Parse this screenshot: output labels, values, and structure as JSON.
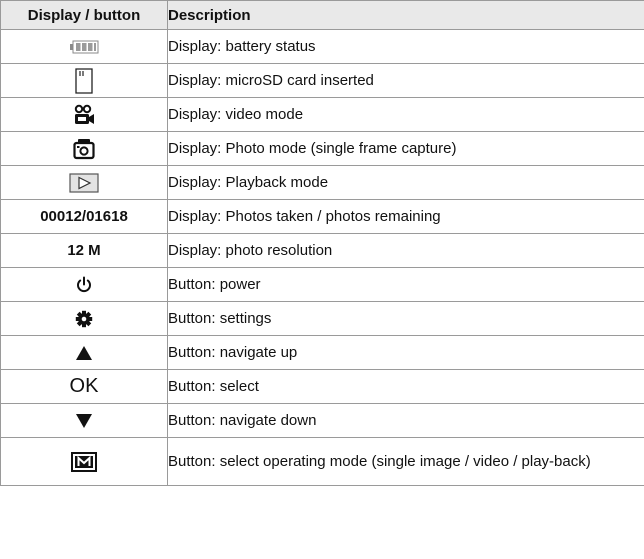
{
  "header": {
    "col1": "Display / button",
    "col2": "Description"
  },
  "rows": [
    {
      "icon": "battery-icon",
      "symbol": "",
      "description": "Display: battery status"
    },
    {
      "icon": "microsd-card-icon",
      "symbol": "",
      "description": "Display: microSD card inserted"
    },
    {
      "icon": "video-camera-icon",
      "symbol": "",
      "description": "Display: video mode"
    },
    {
      "icon": "photo-camera-icon",
      "symbol": "",
      "description": "Display: Photo mode (single frame capture)"
    },
    {
      "icon": "playback-icon",
      "symbol": "",
      "description": "Display: Playback mode"
    },
    {
      "icon": "",
      "symbol": "00012/01618",
      "description": "Display: Photos taken / photos remaining"
    },
    {
      "icon": "",
      "symbol": "12 M",
      "description": "Display: photo resolution"
    },
    {
      "icon": "power-icon",
      "symbol": "",
      "description": "Button: power"
    },
    {
      "icon": "gear-icon",
      "symbol": "",
      "description": "Button: settings"
    },
    {
      "icon": "triangle-up-icon",
      "symbol": "",
      "description": "Button: navigate up"
    },
    {
      "icon": "",
      "symbol": "OK",
      "description": "Button: select"
    },
    {
      "icon": "triangle-down-icon",
      "symbol": "",
      "description": "Button: navigate down"
    },
    {
      "icon": "mode-m-icon",
      "symbol": "",
      "description": "Button: select operating mode (single image / video / play-back)"
    }
  ]
}
